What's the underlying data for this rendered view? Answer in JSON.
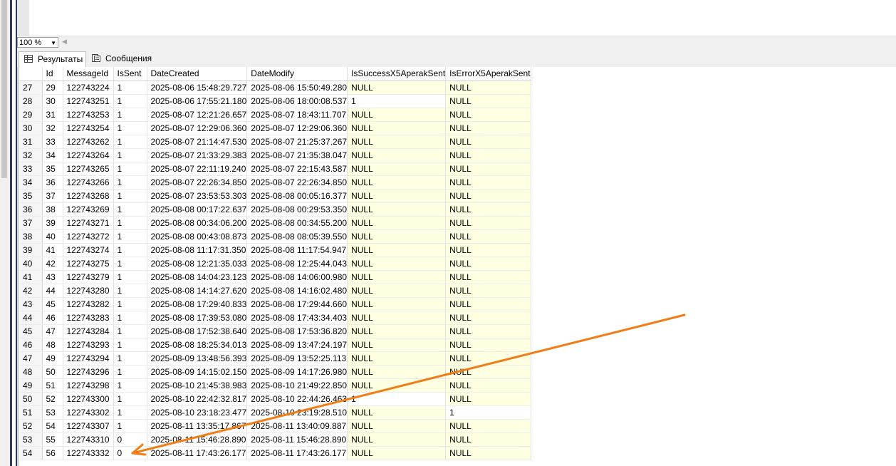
{
  "zoom": {
    "value": "100 %"
  },
  "tabs": [
    {
      "label": "Результаты",
      "active": true
    },
    {
      "label": "Сообщения",
      "active": false
    }
  ],
  "grid": {
    "columns": [
      "Id",
      "MessageId",
      "IsSent",
      "DateCreated",
      "DateModify",
      "IsSuccessX5AperakSent",
      "IsErrorX5AperakSent"
    ],
    "rows": [
      [
        "27",
        "29",
        "122743224",
        "1",
        "2025-08-06 15:48:29.727",
        "2025-08-06 15:50:49.280",
        "NULL",
        "NULL"
      ],
      [
        "28",
        "30",
        "122743251",
        "1",
        "2025-08-06 17:55:21.180",
        "2025-08-06 18:00:08.537",
        "1",
        "NULL"
      ],
      [
        "29",
        "31",
        "122743253",
        "1",
        "2025-08-07 12:21:26.657",
        "2025-08-07 18:43:11.707",
        "NULL",
        "NULL"
      ],
      [
        "30",
        "32",
        "122743254",
        "1",
        "2025-08-07 12:29:06.360",
        "2025-08-07 12:29:06.360",
        "NULL",
        "NULL"
      ],
      [
        "31",
        "33",
        "122743262",
        "1",
        "2025-08-07 21:14:47.530",
        "2025-08-07 21:25:37.267",
        "NULL",
        "NULL"
      ],
      [
        "32",
        "34",
        "122743264",
        "1",
        "2025-08-07 21:33:29.383",
        "2025-08-07 21:35:38.047",
        "NULL",
        "NULL"
      ],
      [
        "33",
        "35",
        "122743265",
        "1",
        "2025-08-07 22:11:19.240",
        "2025-08-07 22:15:43.587",
        "NULL",
        "NULL"
      ],
      [
        "34",
        "36",
        "122743266",
        "1",
        "2025-08-07 22:26:34.850",
        "2025-08-07 22:26:34.850",
        "NULL",
        "NULL"
      ],
      [
        "35",
        "37",
        "122743268",
        "1",
        "2025-08-07 23:53:53.303",
        "2025-08-08 00:05:16.377",
        "NULL",
        "NULL"
      ],
      [
        "36",
        "38",
        "122743269",
        "1",
        "2025-08-08 00:17:22.637",
        "2025-08-08 00:29:53.350",
        "NULL",
        "NULL"
      ],
      [
        "37",
        "39",
        "122743271",
        "1",
        "2025-08-08 00:34:06.200",
        "2025-08-08 00:34:55.200",
        "NULL",
        "NULL"
      ],
      [
        "38",
        "40",
        "122743272",
        "1",
        "2025-08-08 00:43:08.873",
        "2025-08-08 08:05:39.550",
        "NULL",
        "NULL"
      ],
      [
        "39",
        "41",
        "122743274",
        "1",
        "2025-08-08 11:17:31.350",
        "2025-08-08 11:17:54.947",
        "NULL",
        "NULL"
      ],
      [
        "40",
        "42",
        "122743275",
        "1",
        "2025-08-08 12:21:35.033",
        "2025-08-08 12:25:44.043",
        "NULL",
        "NULL"
      ],
      [
        "41",
        "43",
        "122743279",
        "1",
        "2025-08-08 14:04:23.123",
        "2025-08-08 14:06:00.980",
        "NULL",
        "NULL"
      ],
      [
        "42",
        "44",
        "122743280",
        "1",
        "2025-08-08 14:14:27.620",
        "2025-08-08 14:16:02.480",
        "NULL",
        "NULL"
      ],
      [
        "43",
        "45",
        "122743282",
        "1",
        "2025-08-08 17:29:40.833",
        "2025-08-08 17:29:44.660",
        "NULL",
        "NULL"
      ],
      [
        "44",
        "46",
        "122743283",
        "1",
        "2025-08-08 17:39:53.080",
        "2025-08-08 17:43:34.403",
        "NULL",
        "NULL"
      ],
      [
        "45",
        "47",
        "122743284",
        "1",
        "2025-08-08 17:52:38.640",
        "2025-08-08 17:53:36.820",
        "NULL",
        "NULL"
      ],
      [
        "46",
        "48",
        "122743293",
        "1",
        "2025-08-08 18:25:34.013",
        "2025-08-09 13:47:24.197",
        "NULL",
        "NULL"
      ],
      [
        "47",
        "49",
        "122743294",
        "1",
        "2025-08-09 13:48:56.393",
        "2025-08-09 13:52:25.113",
        "NULL",
        "NULL"
      ],
      [
        "48",
        "50",
        "122743296",
        "1",
        "2025-08-09 14:15:02.150",
        "2025-08-09 14:17:26.980",
        "NULL",
        "NULL"
      ],
      [
        "49",
        "51",
        "122743298",
        "1",
        "2025-08-10 21:45:38.983",
        "2025-08-10 21:49:22.850",
        "NULL",
        "NULL"
      ],
      [
        "50",
        "52",
        "122743300",
        "1",
        "2025-08-10 22:42:32.817",
        "2025-08-10 22:44:26.463",
        "1",
        "NULL"
      ],
      [
        "51",
        "53",
        "122743302",
        "1",
        "2025-08-10 23:18:23.477",
        "2025-08-10 23:19:28.510",
        "NULL",
        "1"
      ],
      [
        "52",
        "54",
        "122743307",
        "1",
        "2025-08-11 13:35:17.867",
        "2025-08-11 13:40:09.887",
        "NULL",
        "NULL"
      ],
      [
        "53",
        "55",
        "122743310",
        "0",
        "2025-08-11 15:46:28.890",
        "2025-08-11 15:46:28.890",
        "NULL",
        "NULL"
      ],
      [
        "54",
        "56",
        "122743332",
        "0",
        "2025-08-11 17:43:26.177",
        "2025-08-11 17:43:26.177",
        "NULL",
        "NULL"
      ]
    ]
  },
  "annotation": {
    "arrow_color": "#f07d18"
  },
  "colors": {
    "null_cell": "#ffffe1",
    "selection": "#2b3a55"
  },
  "icons": {
    "results_tab": "grid-icon",
    "messages_tab": "messages-icon"
  }
}
